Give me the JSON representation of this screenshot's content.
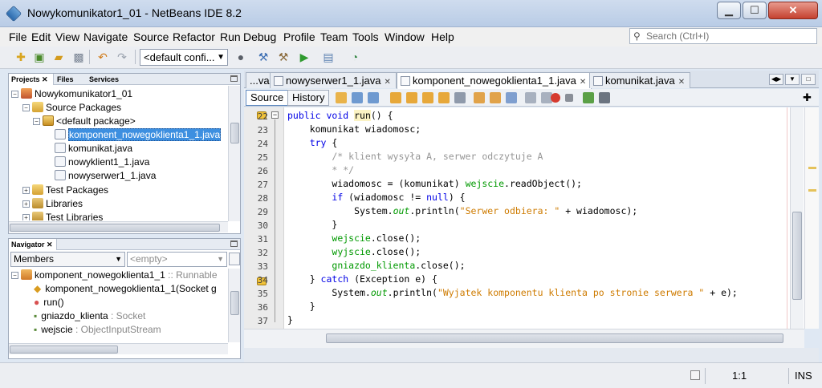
{
  "window": {
    "title": "Nowykomunikator1_01 - NetBeans IDE 8.2"
  },
  "menu": [
    "File",
    "Edit",
    "View",
    "Navigate",
    "Source",
    "Refactor",
    "Run",
    "Debug",
    "Profile",
    "Team",
    "Tools",
    "Window",
    "Help"
  ],
  "search": {
    "placeholder": "Search (Ctrl+I)"
  },
  "toolbar": {
    "config": "<default confi..."
  },
  "projects_panel": {
    "tabs": [
      "Projects",
      "Files",
      "Services"
    ],
    "tree": [
      {
        "label": "Nowykomunikator1_01",
        "icon": "project-icon"
      },
      {
        "label": "Source Packages",
        "icon": "folder-icon"
      },
      {
        "label": "<default package>",
        "icon": "package-icon"
      },
      {
        "label": "komponent_nowegoklienta1_1.java",
        "icon": "java-file-icon",
        "selected": true
      },
      {
        "label": "komunikat.java",
        "icon": "java-file-icon"
      },
      {
        "label": "nowyklient1_1.java",
        "icon": "java-file-icon"
      },
      {
        "label": "nowyserwer1_1.java",
        "icon": "java-file-icon"
      },
      {
        "label": "Test Packages",
        "icon": "folder-icon"
      },
      {
        "label": "Libraries",
        "icon": "library-icon"
      },
      {
        "label": "Test Libraries",
        "icon": "library-icon"
      }
    ]
  },
  "navigator": {
    "title": "Navigator",
    "filter": "Members",
    "filter2": "<empty>",
    "items": [
      {
        "name": "komponent_nowegoklienta1_1",
        "type": " :: Runnable"
      },
      {
        "name": "komponent_nowegoklienta1_1(Socket g",
        "type": ""
      },
      {
        "name": "run()",
        "type": ""
      },
      {
        "name": "gniazdo_klienta",
        "type": " : Socket"
      },
      {
        "name": "wejscie",
        "type": " : ObjectInputStream"
      }
    ]
  },
  "editor": {
    "tabs": [
      "...va",
      "nowyserwer1_1.java",
      "komponent_nowegoklienta1_1.java",
      "komunikat.java"
    ],
    "active_tab": "komponent_nowegoklienta1_1.java",
    "source_label": "Source",
    "history_label": "History",
    "line_numbers": [
      "22",
      "23",
      "24",
      "25",
      "26",
      "27",
      "28",
      "29",
      "30",
      "31",
      "32",
      "33",
      "34",
      "35",
      "36",
      "37"
    ],
    "code": {
      "l22_a": "public void ",
      "l22_b": "run",
      "l22_c": "() {",
      "l23": "    komunikat wiadomosc;",
      "l24_a": "    ",
      "l24_b": "try",
      "l24_c": " {",
      "l25": "        /* klient wysyła A, serwer odczytuje A",
      "l26": "        * */",
      "l27_a": "        wiadomosc = (komunikat) ",
      "l27_b": "wejscie",
      "l27_c": ".readObject();",
      "l28_a": "        ",
      "l28_b": "if",
      "l28_c": " (wiadomosc != ",
      "l28_d": "null",
      "l28_e": ") {",
      "l29_a": "            System.",
      "l29_b": "out",
      "l29_c": ".println(",
      "l29_d": "\"Serwer odbiera: \"",
      "l29_e": " + wiadomosc);",
      "l30": "        }",
      "l31_a": "        ",
      "l31_b": "wejscie",
      "l31_c": ".close();",
      "l32_a": "        ",
      "l32_b": "wyjscie",
      "l32_c": ".close();",
      "l33_a": "        ",
      "l33_b": "gniazdo_klienta",
      "l33_c": ".close();",
      "l34_a": "    } ",
      "l34_b": "catch",
      "l34_c": " (Exception e) {",
      "l35_a": "        System.",
      "l35_b": "out",
      "l35_c": ".println(",
      "l35_d": "\"Wyjatek komponentu klienta po stronie serwera \"",
      "l35_e": " + e);",
      "l36": "    }",
      "l37": "}"
    }
  },
  "status": {
    "position": "1:1",
    "mode": "INS"
  }
}
